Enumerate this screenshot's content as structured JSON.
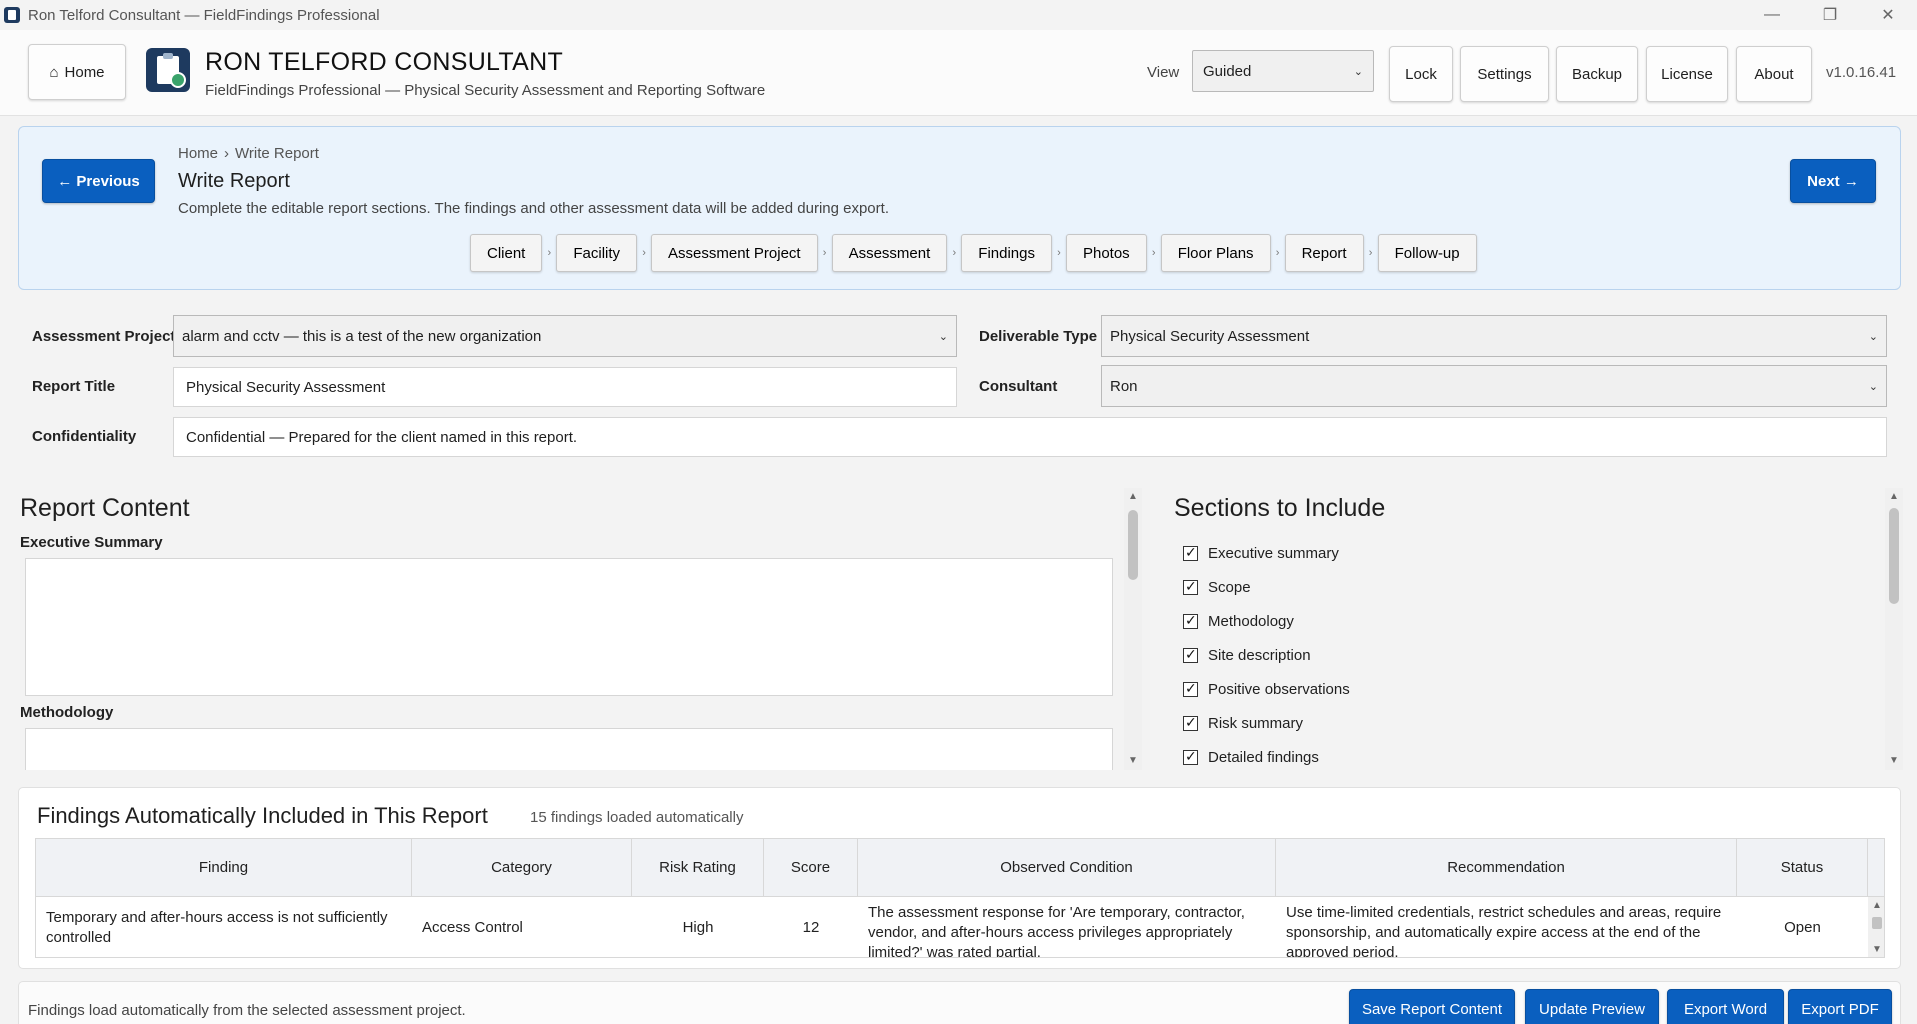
{
  "window": {
    "title": "Ron Telford Consultant — FieldFindings Professional",
    "controls": {
      "minimize": "—",
      "restore": "❐",
      "close": "✕"
    }
  },
  "header": {
    "home_label": "Home",
    "home_icon": "⌂",
    "company": "RON TELFORD CONSULTANT",
    "subtitle": "FieldFindings Professional — Physical Security Assessment and Reporting Software",
    "view_label": "View",
    "view_value": "Guided",
    "buttons": {
      "lock": "Lock",
      "settings": "Settings",
      "backup": "Backup",
      "license": "License",
      "about": "About"
    },
    "version": "v1.0.16.41"
  },
  "nav": {
    "previous": "← Previous",
    "next": "Next →",
    "breadcrumb": {
      "home": "Home",
      "sep": "›",
      "current": "Write Report"
    },
    "title": "Write Report",
    "description": "Complete the editable report sections. The findings and other assessment data will be added during export.",
    "steps": [
      "Client",
      "Facility",
      "Assessment Project",
      "Assessment",
      "Findings",
      "Photos",
      "Floor Plans",
      "Report",
      "Follow-up"
    ],
    "step_sep": "›"
  },
  "form": {
    "assessment_project_label": "Assessment Project",
    "assessment_project_value": "alarm and cctv — this is a test of the new organization",
    "deliverable_type_label": "Deliverable Type",
    "deliverable_type_value": "Physical Security Assessment",
    "report_title_label": "Report Title",
    "report_title_value": "Physical Security Assessment",
    "consultant_label": "Consultant",
    "consultant_value": "Ron",
    "confidentiality_label": "Confidentiality",
    "confidentiality_value": "Confidential — Prepared for the client named in this report."
  },
  "report_content": {
    "heading": "Report Content",
    "executive_summary_label": "Executive Summary",
    "executive_summary_value": "",
    "methodology_label": "Methodology",
    "methodology_value": ""
  },
  "sections": {
    "heading": "Sections to Include",
    "items": [
      {
        "label": "Executive summary",
        "checked": true
      },
      {
        "label": "Scope",
        "checked": true
      },
      {
        "label": "Methodology",
        "checked": true
      },
      {
        "label": "Site description",
        "checked": true
      },
      {
        "label": "Positive observations",
        "checked": true
      },
      {
        "label": "Risk summary",
        "checked": true
      },
      {
        "label": "Detailed findings",
        "checked": true
      }
    ]
  },
  "findings": {
    "heading": "Findings Automatically Included in This Report",
    "count_text": "15 findings loaded automatically",
    "columns": [
      "Finding",
      "Category",
      "Risk Rating",
      "Score",
      "Observed Condition",
      "Recommendation",
      "Status"
    ],
    "rows": [
      {
        "finding": "Temporary and after-hours access is not sufficiently controlled",
        "category": "Access Control",
        "risk": "High",
        "score": "12",
        "observed": "The assessment response for 'Are temporary, contractor, vendor, and after-hours access privileges appropriately limited?' was rated partial.",
        "recommendation": "Use time-limited credentials, restrict schedules and areas, require sponsorship, and automatically expire access at the end of the approved period.",
        "status": "Open"
      }
    ]
  },
  "footer": {
    "note": "Findings load automatically from the selected assessment project.",
    "save": "Save Report Content",
    "update": "Update Preview",
    "export_word": "Export Word",
    "export_pdf": "Export PDF"
  },
  "colors": {
    "primary": "#0a5fbf",
    "nav_bg": "#eaf3fc",
    "nav_border": "#b9d3ee",
    "brand": "#1e3a5f"
  }
}
